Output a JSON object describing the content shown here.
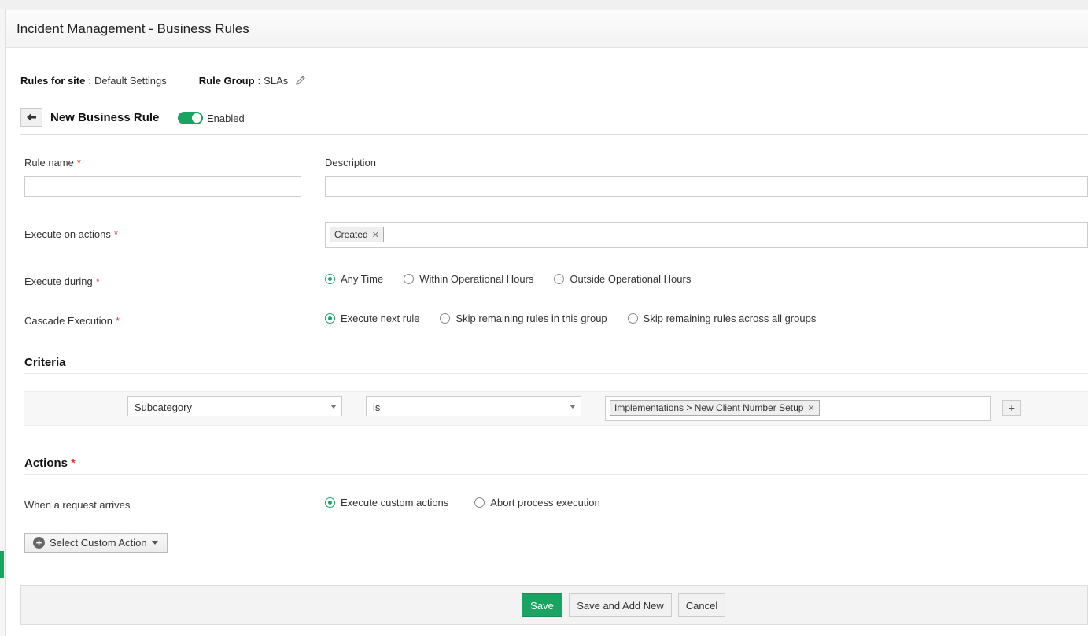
{
  "header": {
    "title": "Incident Management - Business Rules"
  },
  "site": {
    "site_label": "Rules for site",
    "site_value": "Default Settings",
    "group_label": "Rule Group",
    "group_value": "SLAs"
  },
  "rule": {
    "heading": "New Business Rule",
    "enabled_label": "Enabled",
    "enabled": true
  },
  "form": {
    "rule_name_label": "Rule name",
    "rule_name_value": "",
    "description_label": "Description",
    "description_value": "",
    "execute_on_label": "Execute on actions",
    "execute_on_tags": [
      "Created"
    ],
    "execute_during_label": "Execute during",
    "execute_during_options": [
      "Any Time",
      "Within Operational Hours",
      "Outside Operational Hours"
    ],
    "execute_during_selected": "Any Time",
    "cascade_label": "Cascade Execution",
    "cascade_options": [
      "Execute next rule",
      "Skip remaining rules in this group",
      "Skip remaining rules across all groups"
    ],
    "cascade_selected": "Execute next rule"
  },
  "criteria": {
    "title": "Criteria",
    "field": "Subcategory",
    "operator": "is",
    "value_tags": [
      "Implementations > New Client Number Setup"
    ],
    "add_label": "+"
  },
  "actions": {
    "title": "Actions",
    "when_label": "When a request arrives",
    "options": [
      "Execute custom actions",
      "Abort process execution"
    ],
    "selected": "Execute custom actions",
    "custom_action_label": "Select Custom Action"
  },
  "footer": {
    "save": "Save",
    "save_add_new": "Save and Add New",
    "cancel": "Cancel"
  },
  "colors": {
    "accent": "#1aa363",
    "required": "#e23636"
  }
}
